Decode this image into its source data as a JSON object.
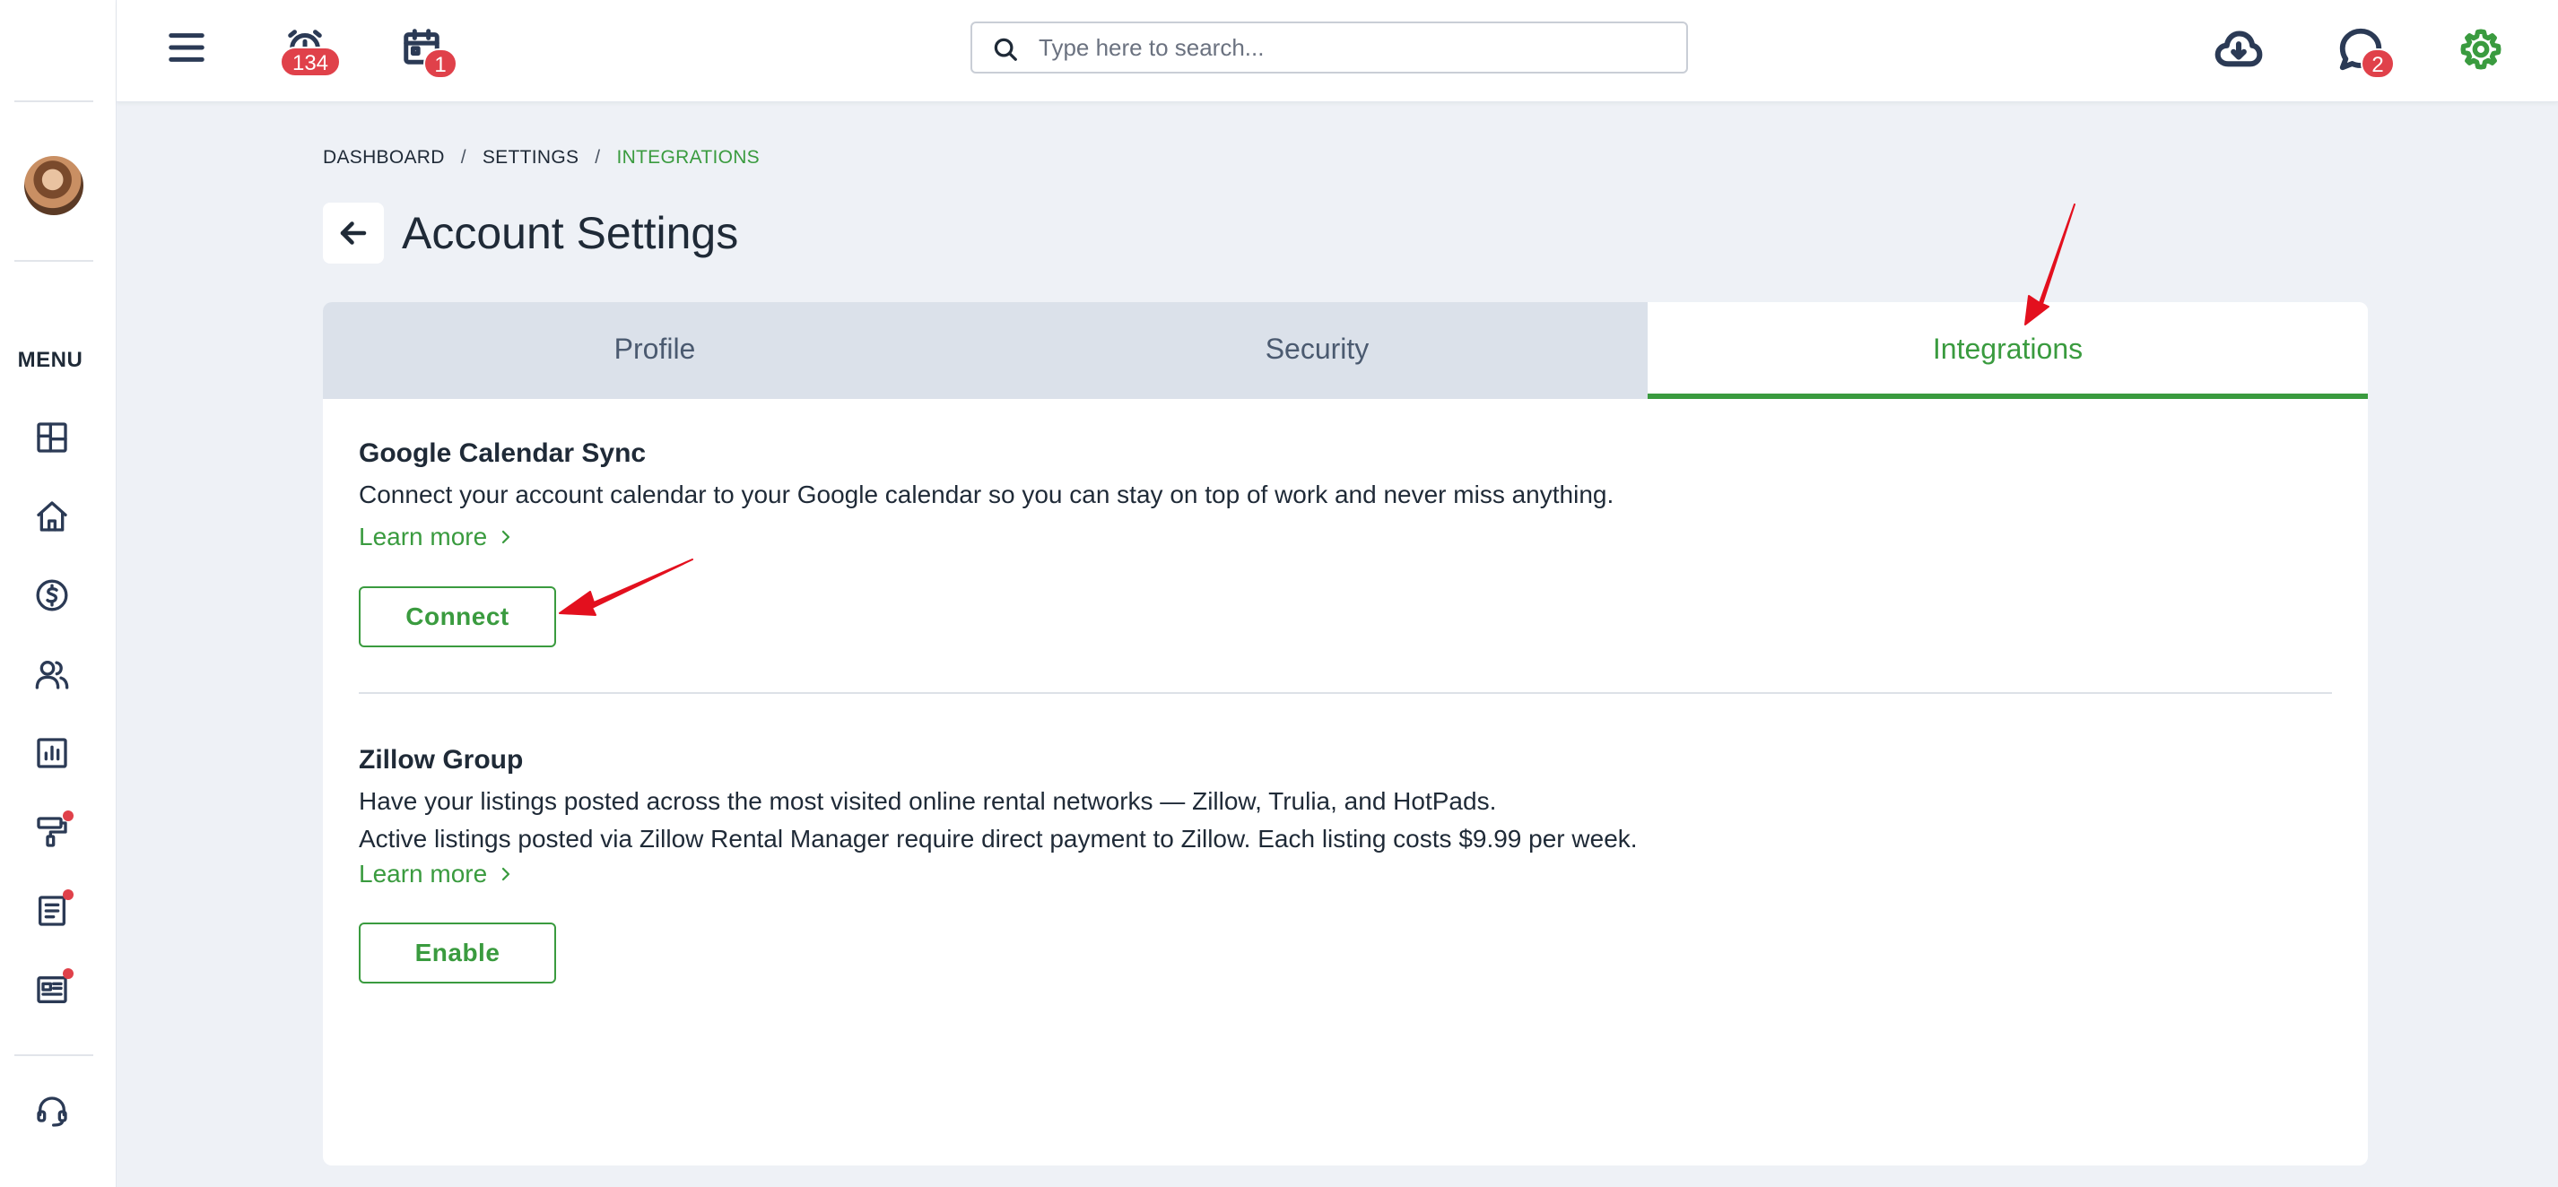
{
  "header": {
    "alarm_badge": "134",
    "calendar_badge": "1",
    "chat_badge": "2",
    "search": {
      "placeholder": "Type here to search..."
    },
    "icons": [
      "menu-icon",
      "alarm-clock-icon",
      "calendar-icon",
      "search-icon",
      "cloud-download-icon",
      "chat-icon",
      "gear-icon"
    ]
  },
  "sidebar": {
    "menu_label": "MENU",
    "items": [
      {
        "icon": "dashboard-icon",
        "alert": false
      },
      {
        "icon": "home-icon",
        "alert": false
      },
      {
        "icon": "dollar-icon",
        "alert": false
      },
      {
        "icon": "users-icon",
        "alert": false
      },
      {
        "icon": "bar-chart-icon",
        "alert": false
      },
      {
        "icon": "paint-roller-icon",
        "alert": true
      },
      {
        "icon": "document-icon",
        "alert": true
      },
      {
        "icon": "newspaper-icon",
        "alert": true
      },
      {
        "icon": "headset-icon",
        "alert": false
      }
    ]
  },
  "breadcrumb": {
    "items": [
      "DASHBOARD",
      "SETTINGS",
      "INTEGRATIONS"
    ],
    "separator": "/"
  },
  "page": {
    "title": "Account Settings"
  },
  "tabs": [
    {
      "label": "Profile",
      "active": false
    },
    {
      "label": "Security",
      "active": false
    },
    {
      "label": "Integrations",
      "active": true
    }
  ],
  "integrations": [
    {
      "title": "Google Calendar Sync",
      "lines": [
        "Connect your account calendar to your Google calendar so you can stay on top of work and never miss anything."
      ],
      "learn_more": "Learn more",
      "button": "Connect"
    },
    {
      "title": "Zillow Group",
      "lines": [
        "Have your listings posted across the most visited online rental networks — Zillow, Trulia, and HotPads.",
        "Active listings posted via Zillow Rental Manager require direct payment to Zillow. Each listing costs $9.99 per week."
      ],
      "learn_more": "Learn more",
      "button": "Enable"
    }
  ],
  "colors": {
    "accent": "#3a9b3f",
    "badge": "#e0414a",
    "annotation_arrow": "#e3101e",
    "page_bg": "#eef1f6"
  }
}
